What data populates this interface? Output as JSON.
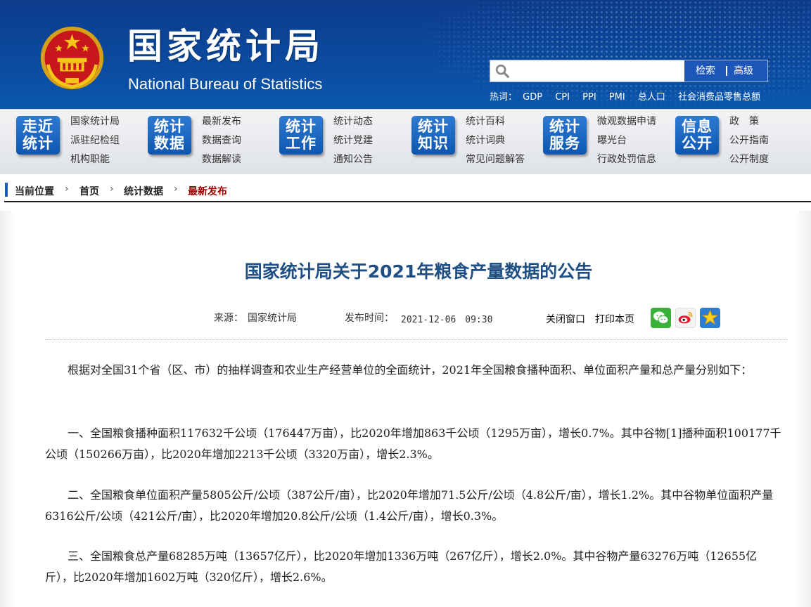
{
  "header": {
    "title_cn": "国家统计局",
    "title_en": "National Bureau of Statistics",
    "search": {
      "placeholder": "",
      "search_label": "检索",
      "advanced_label": "高级"
    },
    "hotwords_label": "热词：",
    "hotwords": [
      "GDP",
      "CPI",
      "PPI",
      "PMI",
      "总人口",
      "社会消费品零售总额"
    ]
  },
  "nav": [
    {
      "badge": [
        "走近",
        "统计"
      ],
      "links": [
        "国家统计局",
        "派驻纪检组",
        "机构职能"
      ]
    },
    {
      "badge": [
        "统计",
        "数据"
      ],
      "links": [
        "最新发布",
        "数据查询",
        "数据解读"
      ]
    },
    {
      "badge": [
        "统计",
        "工作"
      ],
      "links": [
        "统计动态",
        "统计党建",
        "通知公告"
      ]
    },
    {
      "badge": [
        "统计",
        "知识"
      ],
      "links": [
        "统计百科",
        "统计词典",
        "常见问题解答"
      ]
    },
    {
      "badge": [
        "统计",
        "服务"
      ],
      "links": [
        "微观数据申请",
        "曝光台",
        "行政处罚信息"
      ]
    },
    {
      "badge": [
        "信息",
        "公开"
      ],
      "links": [
        "政　策",
        "公开指南",
        "公开制度"
      ]
    }
  ],
  "breadcrumb": {
    "label": "当前位置",
    "items": [
      "首页",
      "统计数据",
      "最新发布"
    ],
    "separator": "›"
  },
  "article": {
    "title": "国家统计局关于2021年粮食产量数据的公告",
    "source_label": "来源：",
    "source": "国家统计局",
    "time_label": "发布时间：",
    "time": "2021-12-06　09:30",
    "close_label": "关闭窗口",
    "print_label": "打印本页",
    "share_icons": [
      "wechat-icon",
      "weibo-icon",
      "favorite-star-icon"
    ],
    "paragraphs": [
      "根据对全国31个省（区、市）的抽样调查和农业生产经营单位的全面统计，2021年全国粮食播种面积、单位面积产量和总产量分别如下：",
      {
        "before": "一、全国粮食播种面积117632千公顷（176447万亩），比2020年增加863千公顷（1295万亩），增长0.7%。其中谷物",
        "note": "[1]",
        "after": "播种面积100177千公顷（150266万亩），比2020年增加2213千公顷（3320万亩），增长2.3%。"
      },
      "二、全国粮食单位面积产量5805公斤/公顷（387公斤/亩），比2020年增加71.5公斤/公顷（4.8公斤/亩），增长1.2%。其中谷物单位面积产量6316公斤/公顷（421公斤/亩），比2020年增加20.8公斤/公顷（1.4公斤/亩），增长0.3%。",
      "三、全国粮食总产量68285万吨（13657亿斤），比2020年增加1336万吨（267亿斤），增长2.0%。其中谷物产量63276万吨（12655亿斤），比2020年增加1602万吨（320亿斤），增长2.6%。"
    ]
  },
  "colors": {
    "header_blue": "#0b4a9e",
    "title_blue": "#1f4f83",
    "current_crumb": "#a10000",
    "badge_blue": "#1565c0"
  }
}
